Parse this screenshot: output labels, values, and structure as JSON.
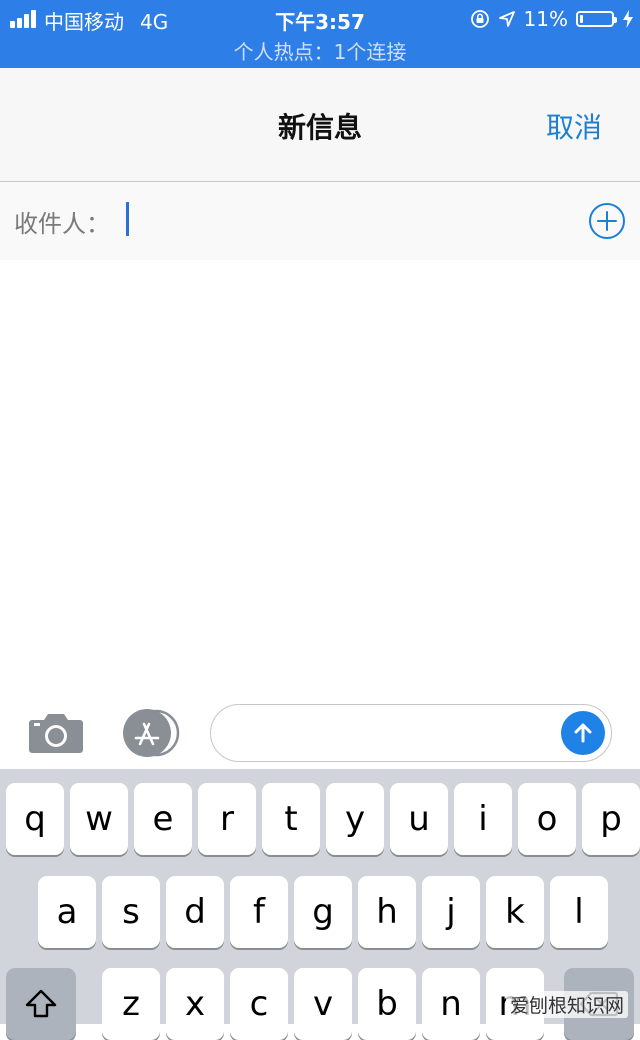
{
  "status_bar": {
    "carrier": "中国移动",
    "network": "4G",
    "time": "下午3:57",
    "battery_percent": "11%",
    "battery_level": 0.11,
    "hotspot": "个人热点：1个连接",
    "colors": {
      "background": "#2d7ee6"
    }
  },
  "nav": {
    "title": "新信息",
    "cancel_label": "取消",
    "accent_color": "#1b7fd6"
  },
  "recipients": {
    "label": "收件人：",
    "value": "",
    "add_icon": "plus-circle-icon"
  },
  "toolbar": {
    "camera_icon": "camera-icon",
    "appstore_icon": "app-store-icon",
    "message_value": "",
    "send_icon": "arrow-up-icon"
  },
  "keyboard": {
    "row1": [
      "q",
      "w",
      "e",
      "r",
      "t",
      "y",
      "u",
      "i",
      "o",
      "p"
    ],
    "row2": [
      "a",
      "s",
      "d",
      "f",
      "g",
      "h",
      "j",
      "k",
      "l"
    ],
    "row3": [
      "z",
      "x",
      "c",
      "v",
      "b",
      "n",
      "m"
    ],
    "shift_icon": "shift-icon",
    "delete_icon": "delete-icon"
  },
  "watermark": "爱刨根知识网"
}
